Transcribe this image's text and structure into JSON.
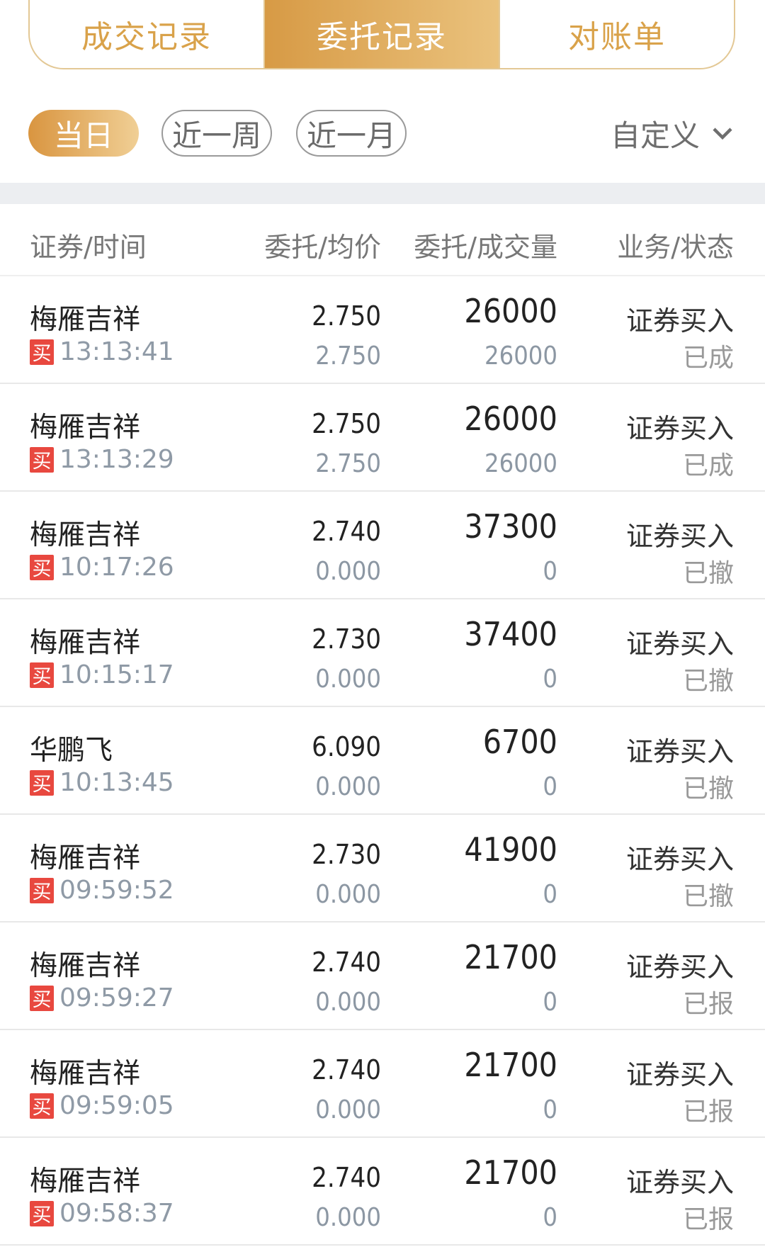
{
  "tabs": {
    "trades": "成交记录",
    "orders": "委托记录",
    "statement": "对账单"
  },
  "filter": {
    "today": "当日",
    "week": "近一周",
    "month": "近一月",
    "custom": "自定义"
  },
  "table": {
    "headers": {
      "security_time": "证券/时间",
      "price": "委托/均价",
      "volume": "委托/成交量",
      "business_status": "业务/状态"
    },
    "rows": [
      {
        "name": "梅雁吉祥",
        "side": "买",
        "time": "13:13:41",
        "price": "2.750",
        "avg": "2.750",
        "qty": "26000",
        "filled": "26000",
        "business": "证券买入",
        "status": "已成"
      },
      {
        "name": "梅雁吉祥",
        "side": "买",
        "time": "13:13:29",
        "price": "2.750",
        "avg": "2.750",
        "qty": "26000",
        "filled": "26000",
        "business": "证券买入",
        "status": "已成"
      },
      {
        "name": "梅雁吉祥",
        "side": "买",
        "time": "10:17:26",
        "price": "2.740",
        "avg": "0.000",
        "qty": "37300",
        "filled": "0",
        "business": "证券买入",
        "status": "已撤"
      },
      {
        "name": "梅雁吉祥",
        "side": "买",
        "time": "10:15:17",
        "price": "2.730",
        "avg": "0.000",
        "qty": "37400",
        "filled": "0",
        "business": "证券买入",
        "status": "已撤"
      },
      {
        "name": "华鹏飞",
        "side": "买",
        "time": "10:13:45",
        "price": "6.090",
        "avg": "0.000",
        "qty": "6700",
        "filled": "0",
        "business": "证券买入",
        "status": "已撤"
      },
      {
        "name": "梅雁吉祥",
        "side": "买",
        "time": "09:59:52",
        "price": "2.730",
        "avg": "0.000",
        "qty": "41900",
        "filled": "0",
        "business": "证券买入",
        "status": "已撤"
      },
      {
        "name": "梅雁吉祥",
        "side": "买",
        "time": "09:59:27",
        "price": "2.740",
        "avg": "0.000",
        "qty": "21700",
        "filled": "0",
        "business": "证券买入",
        "status": "已报"
      },
      {
        "name": "梅雁吉祥",
        "side": "买",
        "time": "09:59:05",
        "price": "2.740",
        "avg": "0.000",
        "qty": "21700",
        "filled": "0",
        "business": "证券买入",
        "status": "已报"
      },
      {
        "name": "梅雁吉祥",
        "side": "买",
        "time": "09:58:37",
        "price": "2.740",
        "avg": "0.000",
        "qty": "21700",
        "filled": "0",
        "business": "证券买入",
        "status": "已报"
      }
    ]
  },
  "colors": {
    "accent_gold": "#d99a45",
    "buy_red": "#e8483f"
  }
}
